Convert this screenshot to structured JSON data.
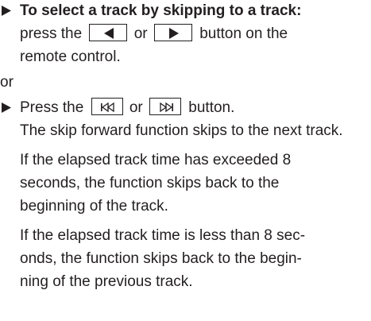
{
  "step1": {
    "heading": "To select a track by skipping to a track:",
    "text_prefix": "press the",
    "or_word": "or",
    "text_suffix": "button on the",
    "text_line3": "remote control.",
    "left_button_icon": "left-arrow-icon",
    "right_button_icon": "right-arrow-icon"
  },
  "separator": "or",
  "step2": {
    "text_prefix": "Press the",
    "or_word": "or",
    "text_suffix": "button.",
    "prev_button_icon": "skip-back-icon",
    "next_button_icon": "skip-forward-icon",
    "para1": "The skip forward function skips to the next track.",
    "para2": "If the elapsed track time has exceeded 8 seconds, the function skips back to the beginning of the track.",
    "para3_line1": "If the elapsed track time is less than 8 sec-",
    "para3_line2": "onds, the function skips back to the begin-",
    "para3_line3": "ning of the previous track."
  }
}
